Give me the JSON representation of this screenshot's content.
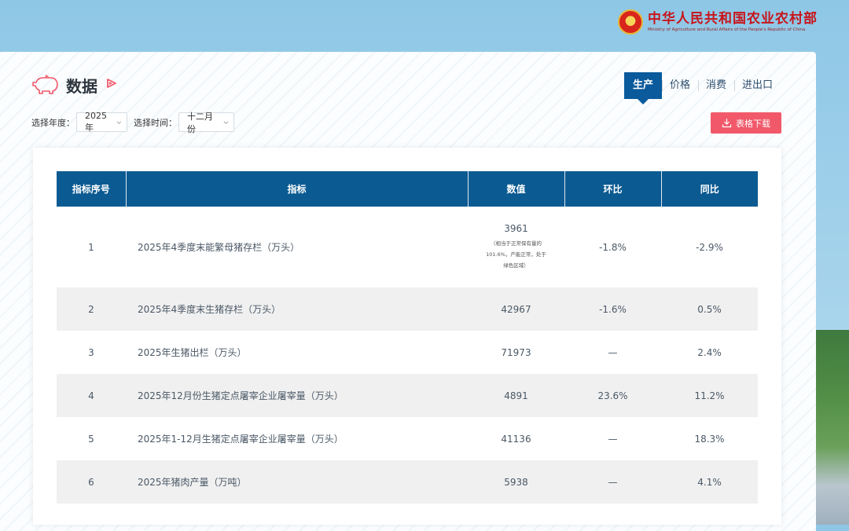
{
  "header": {
    "ministry_cn": "中华人民共和国农业农村部",
    "ministry_en": "Ministry of Agriculture and Rural Affairs of the People's Republic of China"
  },
  "page": {
    "title": "数据",
    "icons": {
      "title_icon": "pig-icon",
      "title_arrow": "play-arrow-icon"
    }
  },
  "tabs": [
    {
      "label": "生产",
      "active": true
    },
    {
      "label": "价格",
      "active": false
    },
    {
      "label": "消费",
      "active": false
    },
    {
      "label": "进出口",
      "active": false
    }
  ],
  "filters": {
    "year_label": "选择年度：",
    "year_value": "2025年",
    "time_label": "选择时间：",
    "time_value": "十二月份"
  },
  "download": {
    "label": "表格下载"
  },
  "table": {
    "headers": [
      "指标序号",
      "指标",
      "数值",
      "环比",
      "同比"
    ],
    "rows": [
      {
        "no": "1",
        "indicator": "2025年4季度末能繁母猪存栏（万头）",
        "value": "3961",
        "note": "（相当于正常保有量的101.6%，产能正常，处于绿色区域）",
        "mom": "-1.8%",
        "yoy": "-2.9%"
      },
      {
        "no": "2",
        "indicator": "2025年4季度末生猪存栏（万头）",
        "value": "42967",
        "mom": "-1.6%",
        "yoy": "0.5%"
      },
      {
        "no": "3",
        "indicator": "2025年生猪出栏（万头）",
        "value": "71973",
        "mom": "—",
        "yoy": "2.4%"
      },
      {
        "no": "4",
        "indicator": "2025年12月份生猪定点屠宰企业屠宰量（万头）",
        "value": "4891",
        "mom": "23.6%",
        "yoy": "11.2%"
      },
      {
        "no": "5",
        "indicator": "2025年1-12月生猪定点屠宰企业屠宰量（万头）",
        "value": "41136",
        "mom": "—",
        "yoy": "18.3%"
      },
      {
        "no": "6",
        "indicator": "2025年猪肉产量（万吨）",
        "value": "5938",
        "mom": "—",
        "yoy": "4.1%"
      }
    ]
  },
  "colors": {
    "header_bg": "#0b5a92",
    "tab_active": "#0a5a9c",
    "download_btn": "#f1596a",
    "ministry_red": "#c8141b"
  }
}
